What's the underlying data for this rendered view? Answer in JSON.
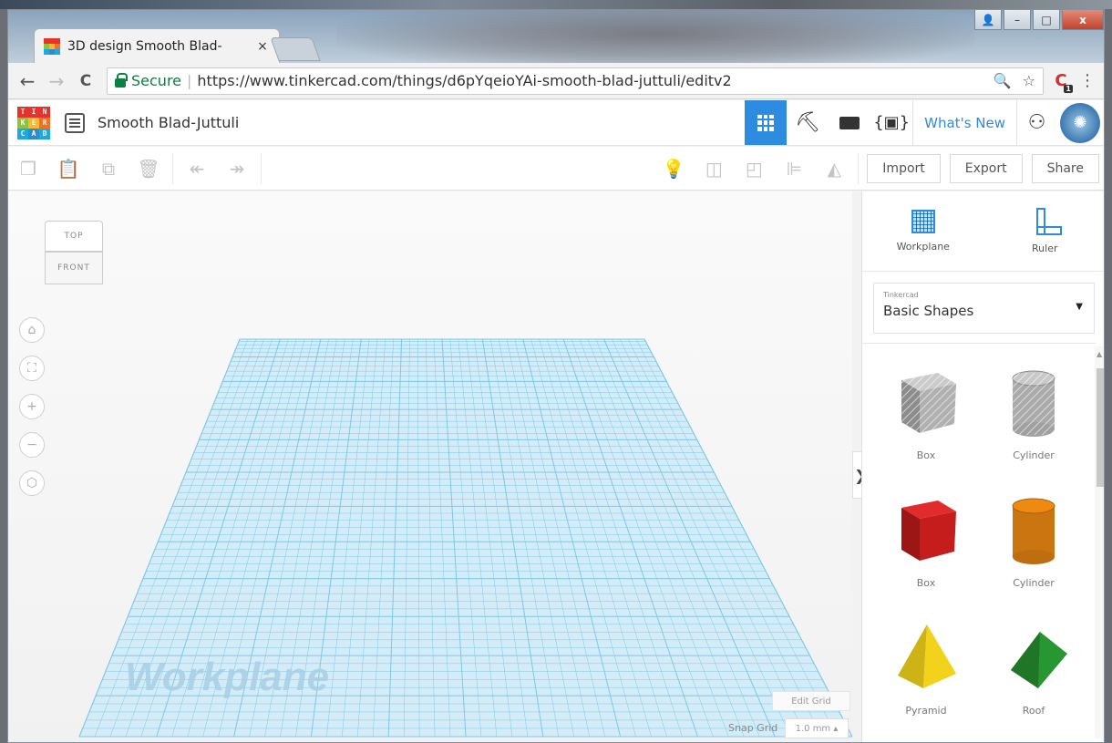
{
  "browser": {
    "tab_title": "3D design Smooth Blad-",
    "tab_close": "×",
    "secure_label": "Secure",
    "separator": "|",
    "url": "https://www.tinkercad.com/things/d6pYqeioYAi-smooth-blad-juttuli/editv2",
    "window_controls": {
      "user": "👤",
      "minimize": "–",
      "maximize": "□",
      "close": "x"
    },
    "nav": {
      "back": "←",
      "forward": "→",
      "reload": "C"
    },
    "omni_icons": {
      "zoom": "🔍",
      "star": "☆"
    },
    "extension_badge": "1",
    "menu": "⋮"
  },
  "app": {
    "logo_letters": [
      "T",
      "I",
      "N",
      "K",
      "E",
      "R",
      "C",
      "A",
      "D"
    ],
    "logo_colors": [
      "#e5322d",
      "#e5322d",
      "#e5322d",
      "#8bc53f",
      "#fbb731",
      "#f37021",
      "#1ba9e1",
      "#2e8ccc",
      "#1ba9e1"
    ],
    "design_title": "Smooth Blad-Juttuli",
    "header_buttons": [
      {
        "name": "3d-view-button",
        "icon": "grid-icon",
        "active": true
      },
      {
        "name": "blocks-button",
        "icon": "pickaxe-icon",
        "active": false
      },
      {
        "name": "bricks-button",
        "icon": "brick-icon",
        "active": false
      },
      {
        "name": "codeblocks-button",
        "icon": "code-icon",
        "active": false
      }
    ],
    "whats_new": "What's New",
    "accent": "#2d8be0"
  },
  "edit_toolbar": {
    "import": "Import",
    "export": "Export",
    "share": "Share"
  },
  "viewport": {
    "viewcube_top": "TOP",
    "viewcube_front": "FRONT",
    "workplane_watermark": "Workplane",
    "edit_grid": "Edit Grid",
    "snap_grid_label": "Snap Grid",
    "snap_grid_value": "1.0 mm ▴",
    "collapse_arrow": "❯",
    "grid_color": "#7ec7e8"
  },
  "panel": {
    "workplane_label": "Workplane",
    "ruler_label": "Ruler",
    "library_small": "Tinkercad",
    "library_name": "Basic Shapes",
    "library_caret": "▼",
    "shapes": [
      {
        "name": "Box",
        "kind": "box-hole",
        "color": "#c8c8c8"
      },
      {
        "name": "Cylinder",
        "kind": "cylinder-hole",
        "color": "#c8c8c8"
      },
      {
        "name": "Box",
        "kind": "box",
        "color": "#e02020"
      },
      {
        "name": "Cylinder",
        "kind": "cylinder",
        "color": "#ee8a12"
      },
      {
        "name": "Pyramid",
        "kind": "pyramid",
        "color": "#f2d21a"
      },
      {
        "name": "Roof",
        "kind": "roof",
        "color": "#2ea836"
      }
    ]
  }
}
